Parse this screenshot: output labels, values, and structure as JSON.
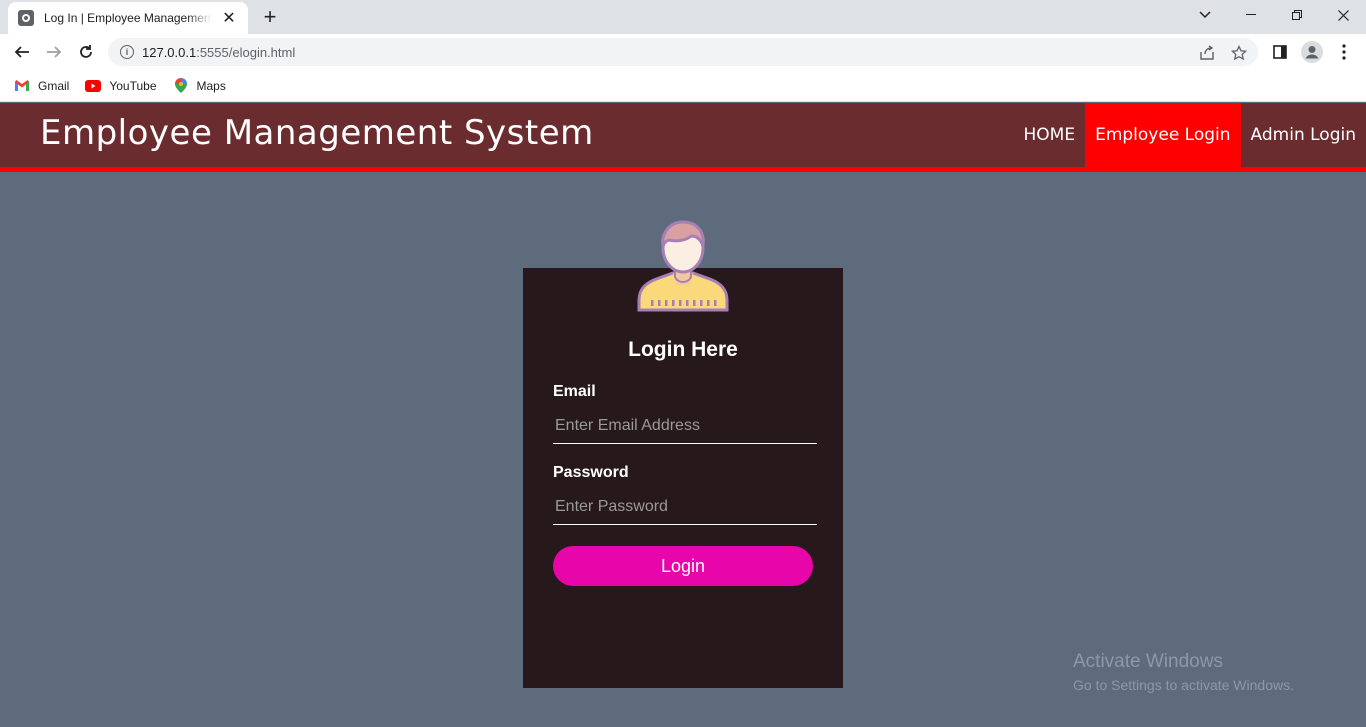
{
  "browser": {
    "tab_title": "Log In | Employee Management System",
    "url_host": "127.0.0.1",
    "url_path": ":5555/elogin.html",
    "bookmarks": [
      {
        "label": "Gmail",
        "icon": "gmail-icon"
      },
      {
        "label": "YouTube",
        "icon": "youtube-icon"
      },
      {
        "label": "Maps",
        "icon": "maps-icon"
      }
    ]
  },
  "header": {
    "brand": "Employee Management System",
    "nav": [
      {
        "label": "HOME",
        "active": false
      },
      {
        "label": "Employee Login",
        "active": true
      },
      {
        "label": "Admin Login",
        "active": false
      }
    ],
    "colors": {
      "bar": "#6b2c2f",
      "accent": "#ff0000"
    }
  },
  "login": {
    "title": "Login Here",
    "email_label": "Email",
    "email_placeholder": "Enter Email Address",
    "password_label": "Password",
    "password_placeholder": "Enter Password",
    "button_label": "Login",
    "colors": {
      "card": "#27181b",
      "button": "#e805a9"
    }
  },
  "watermark": {
    "title": "Activate Windows",
    "subtitle": "Go to Settings to activate Windows."
  }
}
